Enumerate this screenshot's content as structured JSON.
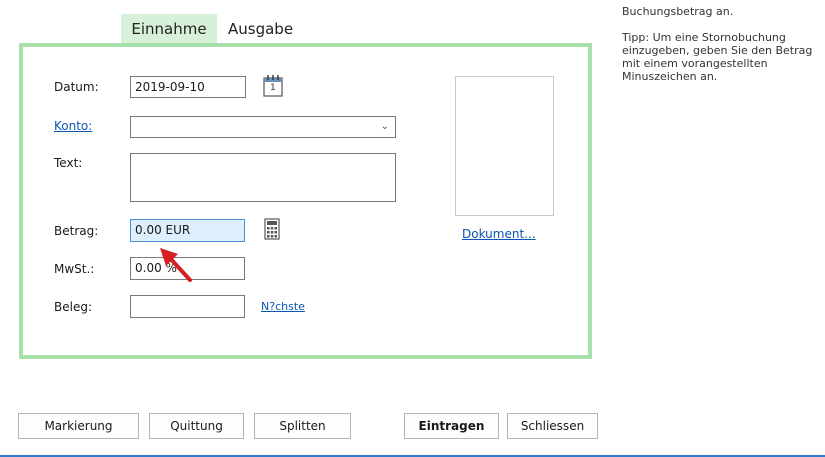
{
  "help": {
    "line1": "Buchungsbetrag an.",
    "tip": "Tipp: Um eine Stornobuchung einzugeben, geben Sie den Betrag mit einem vorangestellten Minuszeichen an."
  },
  "tabs": {
    "income": "Einnahme",
    "expense": "Ausgabe"
  },
  "form": {
    "date_label": "Datum:",
    "date_value": "2019-09-10",
    "calendar_day": "1",
    "account_label": "Konto:",
    "account_value": "",
    "text_label": "Text:",
    "text_value": "",
    "amount_label": "Betrag:",
    "amount_value": "0.00 EUR",
    "vat_label": "MwSt.:",
    "vat_value": "0.00 %",
    "receipt_label": "Beleg:",
    "receipt_value": "",
    "next_link": "N?chste",
    "document_link": "Dokument..."
  },
  "buttons": {
    "mark": "Markierung",
    "receipt": "Quittung",
    "split": "Splitten",
    "enter": "Eintragen",
    "close": "Schliessen"
  },
  "colors": {
    "accent_green": "#a7e0aa",
    "tab_green": "#d6f1d8",
    "link_blue": "#0b55b4",
    "arrow_red": "#d42020"
  }
}
